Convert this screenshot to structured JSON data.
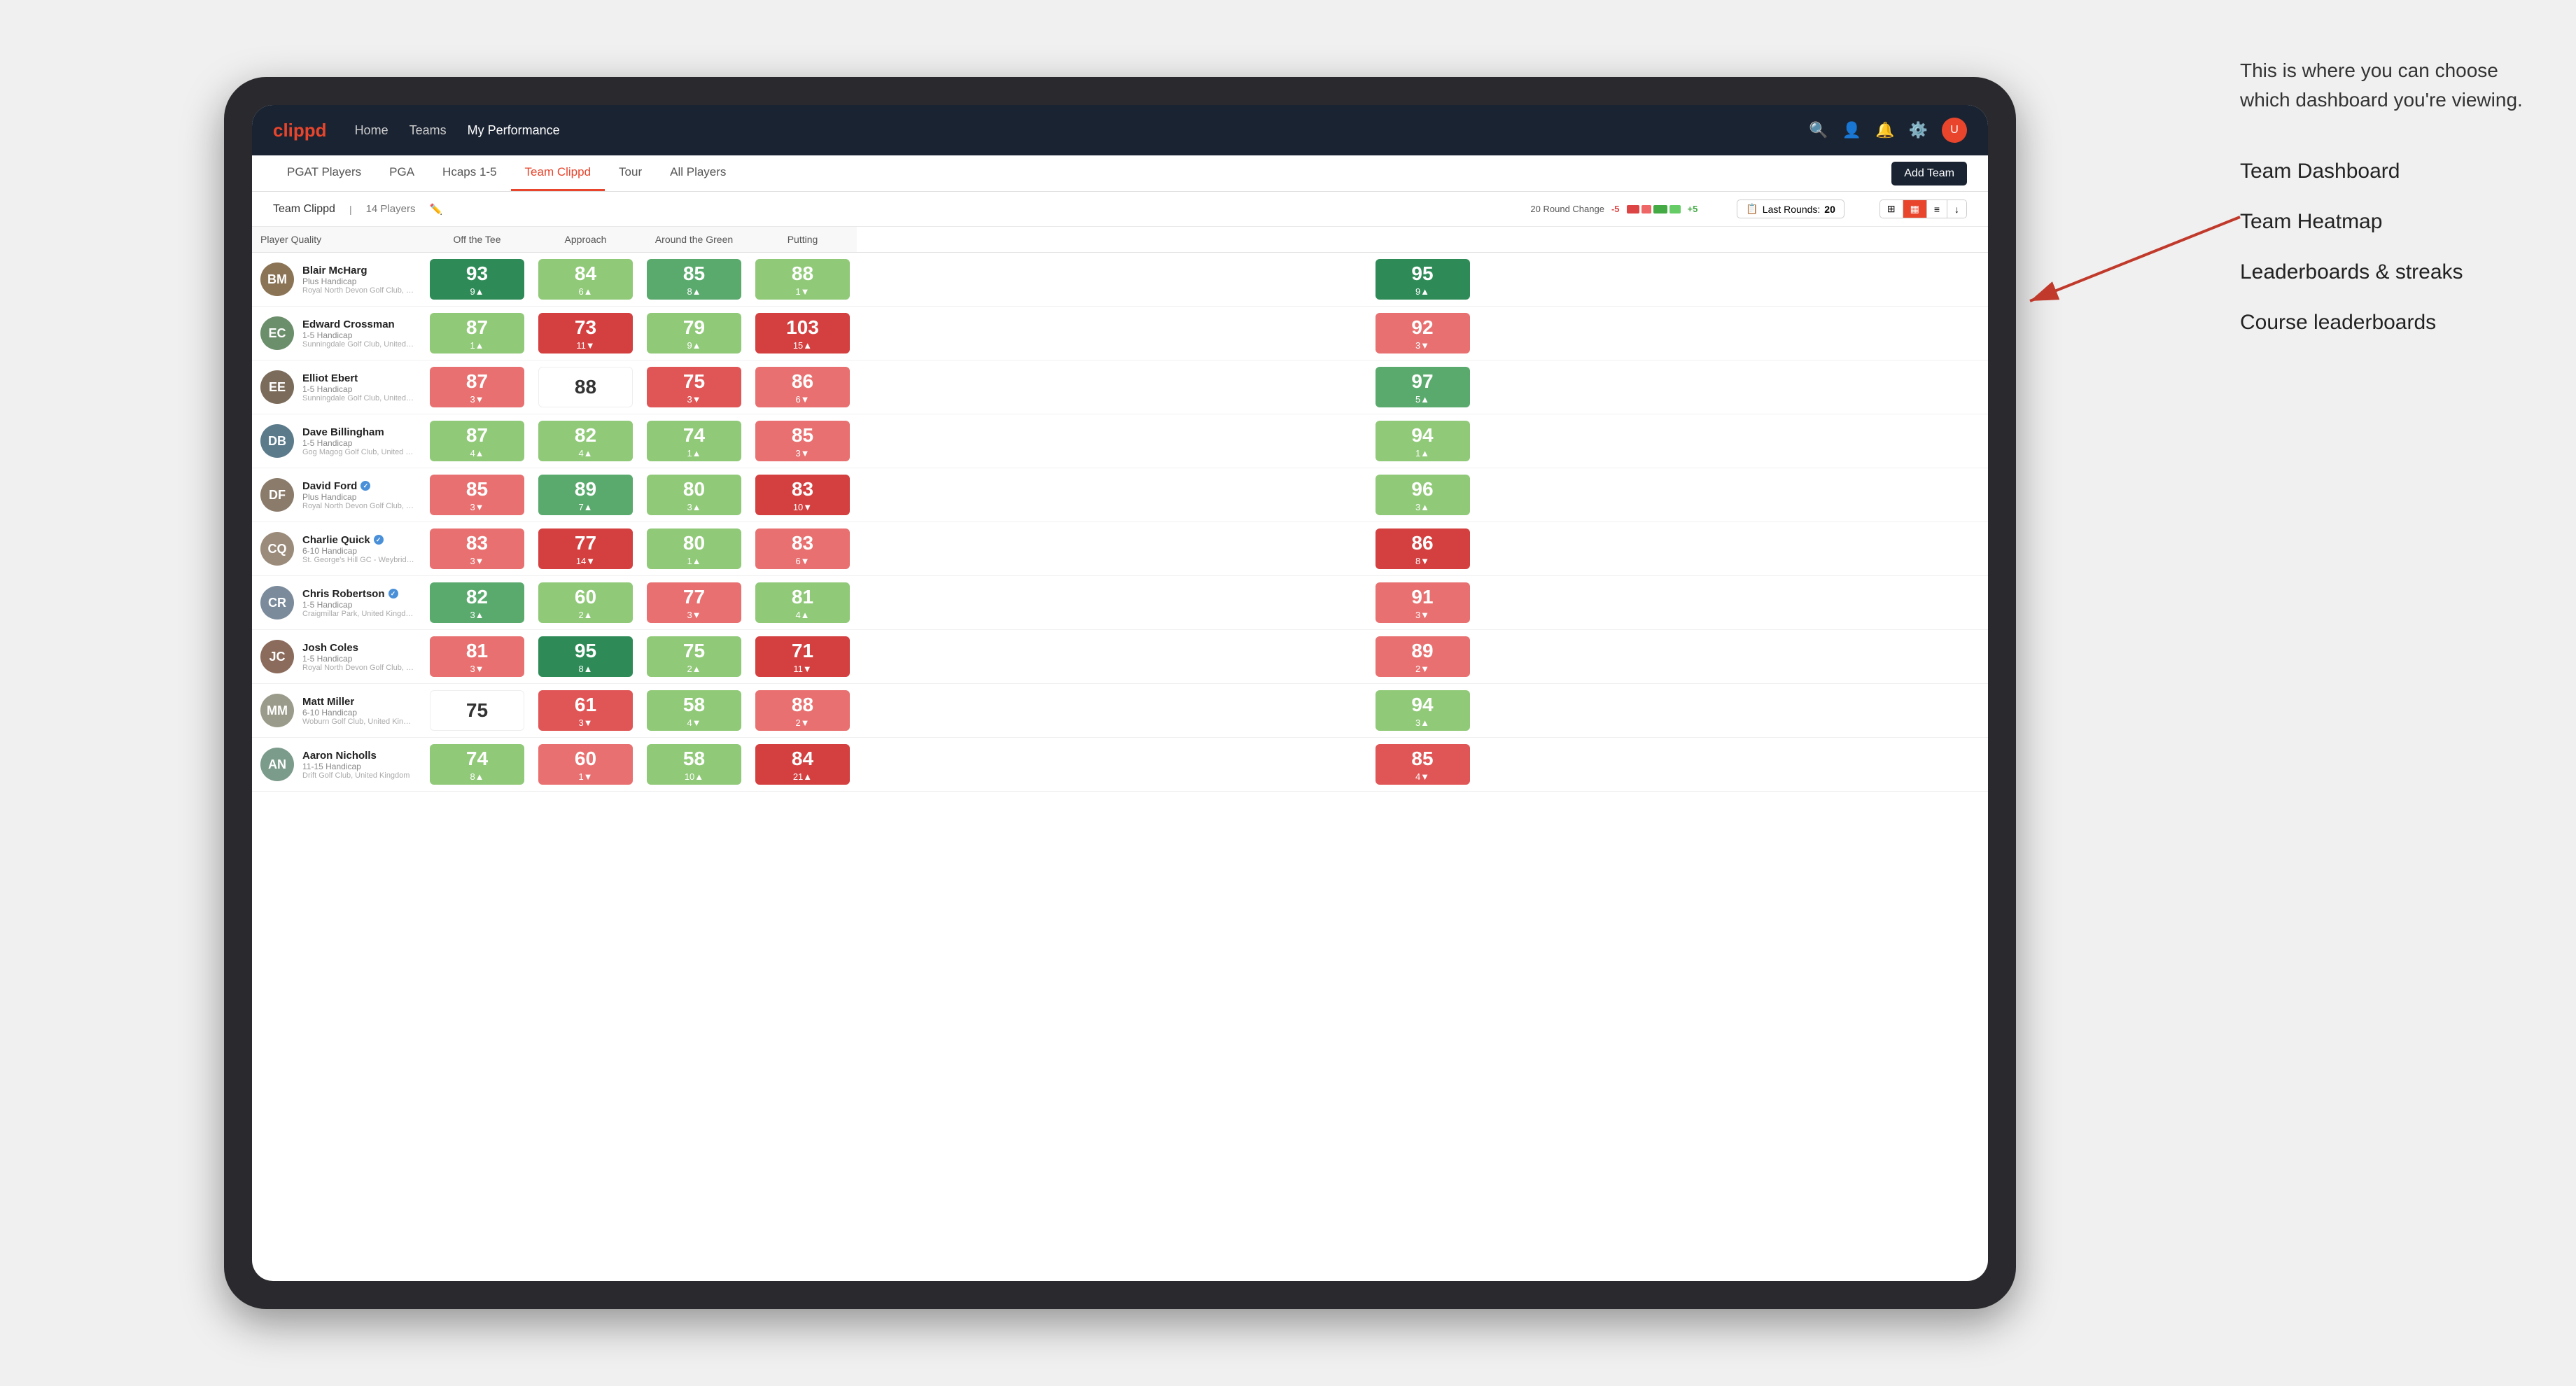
{
  "annotation": {
    "intro": "This is where you can choose which dashboard you're viewing.",
    "items": [
      "Team Dashboard",
      "Team Heatmap",
      "Leaderboards & streaks",
      "Course leaderboards"
    ]
  },
  "nav": {
    "logo": "clippd",
    "links": [
      "Home",
      "Teams",
      "My Performance"
    ],
    "active_link": "My Performance"
  },
  "sub_tabs": [
    "PGAT Players",
    "PGA",
    "Hcaps 1-5",
    "Team Clippd",
    "Tour",
    "All Players"
  ],
  "active_sub_tab": "Team Clippd",
  "add_team_label": "Add Team",
  "team": {
    "name": "Team Clippd",
    "count": "14 Players"
  },
  "filters": {
    "round_change_label": "20 Round Change",
    "round_change_minus": "-5",
    "round_change_plus": "+5",
    "last_rounds_label": "Last Rounds:",
    "last_rounds_value": "20"
  },
  "columns": {
    "player": "Player Quality",
    "off_tee": "Off the Tee",
    "approach": "Approach",
    "around_green": "Around the Green",
    "putting": "Putting"
  },
  "players": [
    {
      "name": "Blair McHarg",
      "handicap": "Plus Handicap",
      "club": "Royal North Devon Golf Club, United Kingdom",
      "initials": "BM",
      "avatar_color": "#8B7355",
      "quality": {
        "value": "93",
        "change": "9",
        "dir": "up",
        "bg": "bg-green-dark"
      },
      "off_tee": {
        "value": "84",
        "change": "6",
        "dir": "up",
        "bg": "bg-green-light"
      },
      "approach": {
        "value": "85",
        "change": "8",
        "dir": "up",
        "bg": "bg-green-mid"
      },
      "around_green": {
        "value": "88",
        "change": "1",
        "dir": "down",
        "bg": "bg-green-light"
      },
      "putting": {
        "value": "95",
        "change": "9",
        "dir": "up",
        "bg": "bg-green-dark"
      }
    },
    {
      "name": "Edward Crossman",
      "handicap": "1-5 Handicap",
      "club": "Sunningdale Golf Club, United Kingdom",
      "initials": "EC",
      "avatar_color": "#6B8E6B",
      "quality": {
        "value": "87",
        "change": "1",
        "dir": "up",
        "bg": "bg-green-light"
      },
      "off_tee": {
        "value": "73",
        "change": "11",
        "dir": "down",
        "bg": "bg-red-dark"
      },
      "approach": {
        "value": "79",
        "change": "9",
        "dir": "up",
        "bg": "bg-green-light"
      },
      "around_green": {
        "value": "103",
        "change": "15",
        "dir": "up",
        "bg": "bg-red-dark"
      },
      "putting": {
        "value": "92",
        "change": "3",
        "dir": "down",
        "bg": "bg-red-light"
      }
    },
    {
      "name": "Elliot Ebert",
      "handicap": "1-5 Handicap",
      "club": "Sunningdale Golf Club, United Kingdom",
      "initials": "EE",
      "avatar_color": "#7B6B5B",
      "quality": {
        "value": "87",
        "change": "3",
        "dir": "down",
        "bg": "bg-red-light"
      },
      "off_tee": {
        "value": "88",
        "change": "",
        "dir": "",
        "bg": "bg-white"
      },
      "approach": {
        "value": "75",
        "change": "3",
        "dir": "down",
        "bg": "bg-red-mid"
      },
      "around_green": {
        "value": "86",
        "change": "6",
        "dir": "down",
        "bg": "bg-red-light"
      },
      "putting": {
        "value": "97",
        "change": "5",
        "dir": "up",
        "bg": "bg-green-mid"
      }
    },
    {
      "name": "Dave Billingham",
      "handicap": "1-5 Handicap",
      "club": "Gog Magog Golf Club, United Kingdom",
      "initials": "DB",
      "avatar_color": "#5B7B8B",
      "quality": {
        "value": "87",
        "change": "4",
        "dir": "up",
        "bg": "bg-green-light"
      },
      "off_tee": {
        "value": "82",
        "change": "4",
        "dir": "up",
        "bg": "bg-green-light"
      },
      "approach": {
        "value": "74",
        "change": "1",
        "dir": "up",
        "bg": "bg-green-light"
      },
      "around_green": {
        "value": "85",
        "change": "3",
        "dir": "down",
        "bg": "bg-red-light"
      },
      "putting": {
        "value": "94",
        "change": "1",
        "dir": "up",
        "bg": "bg-green-light"
      }
    },
    {
      "name": "David Ford",
      "handicap": "Plus Handicap",
      "club": "Royal North Devon Golf Club, United Kingdom",
      "initials": "DF",
      "avatar_color": "#8B7B6B",
      "verified": true,
      "quality": {
        "value": "85",
        "change": "3",
        "dir": "down",
        "bg": "bg-red-light"
      },
      "off_tee": {
        "value": "89",
        "change": "7",
        "dir": "up",
        "bg": "bg-green-mid"
      },
      "approach": {
        "value": "80",
        "change": "3",
        "dir": "up",
        "bg": "bg-green-light"
      },
      "around_green": {
        "value": "83",
        "change": "10",
        "dir": "down",
        "bg": "bg-red-dark"
      },
      "putting": {
        "value": "96",
        "change": "3",
        "dir": "up",
        "bg": "bg-green-light"
      }
    },
    {
      "name": "Charlie Quick",
      "handicap": "6-10 Handicap",
      "club": "St. George's Hill GC - Weybridge - Surrey, Uni...",
      "initials": "CQ",
      "avatar_color": "#9B8B7B",
      "verified": true,
      "quality": {
        "value": "83",
        "change": "3",
        "dir": "down",
        "bg": "bg-red-light"
      },
      "off_tee": {
        "value": "77",
        "change": "14",
        "dir": "down",
        "bg": "bg-red-dark"
      },
      "approach": {
        "value": "80",
        "change": "1",
        "dir": "up",
        "bg": "bg-green-light"
      },
      "around_green": {
        "value": "83",
        "change": "6",
        "dir": "down",
        "bg": "bg-red-light"
      },
      "putting": {
        "value": "86",
        "change": "8",
        "dir": "down",
        "bg": "bg-red-dark"
      }
    },
    {
      "name": "Chris Robertson",
      "handicap": "1-5 Handicap",
      "club": "Craigmillar Park, United Kingdom",
      "initials": "CR",
      "avatar_color": "#7B8B9B",
      "verified": true,
      "quality": {
        "value": "82",
        "change": "3",
        "dir": "up",
        "bg": "bg-green-mid"
      },
      "off_tee": {
        "value": "60",
        "change": "2",
        "dir": "up",
        "bg": "bg-green-light"
      },
      "approach": {
        "value": "77",
        "change": "3",
        "dir": "down",
        "bg": "bg-red-light"
      },
      "around_green": {
        "value": "81",
        "change": "4",
        "dir": "up",
        "bg": "bg-green-light"
      },
      "putting": {
        "value": "91",
        "change": "3",
        "dir": "down",
        "bg": "bg-red-light"
      }
    },
    {
      "name": "Josh Coles",
      "handicap": "1-5 Handicap",
      "club": "Royal North Devon Golf Club, United Kingdom",
      "initials": "JC",
      "avatar_color": "#8B6B5B",
      "quality": {
        "value": "81",
        "change": "3",
        "dir": "down",
        "bg": "bg-red-light"
      },
      "off_tee": {
        "value": "95",
        "change": "8",
        "dir": "up",
        "bg": "bg-green-dark"
      },
      "approach": {
        "value": "75",
        "change": "2",
        "dir": "up",
        "bg": "bg-green-light"
      },
      "around_green": {
        "value": "71",
        "change": "11",
        "dir": "down",
        "bg": "bg-red-dark"
      },
      "putting": {
        "value": "89",
        "change": "2",
        "dir": "down",
        "bg": "bg-red-light"
      }
    },
    {
      "name": "Matt Miller",
      "handicap": "6-10 Handicap",
      "club": "Woburn Golf Club, United Kingdom",
      "initials": "MM",
      "avatar_color": "#9B9B8B",
      "quality": {
        "value": "75",
        "change": "",
        "dir": "",
        "bg": "bg-white"
      },
      "off_tee": {
        "value": "61",
        "change": "3",
        "dir": "down",
        "bg": "bg-red-mid"
      },
      "approach": {
        "value": "58",
        "change": "4",
        "dir": "down",
        "bg": "bg-green-light"
      },
      "around_green": {
        "value": "88",
        "change": "2",
        "dir": "down",
        "bg": "bg-red-light"
      },
      "putting": {
        "value": "94",
        "change": "3",
        "dir": "up",
        "bg": "bg-green-light"
      }
    },
    {
      "name": "Aaron Nicholls",
      "handicap": "11-15 Handicap",
      "club": "Drift Golf Club, United Kingdom",
      "initials": "AN",
      "avatar_color": "#7B9B8B",
      "quality": {
        "value": "74",
        "change": "8",
        "dir": "up",
        "bg": "bg-green-light"
      },
      "off_tee": {
        "value": "60",
        "change": "1",
        "dir": "down",
        "bg": "bg-red-light"
      },
      "approach": {
        "value": "58",
        "change": "10",
        "dir": "up",
        "bg": "bg-green-light"
      },
      "around_green": {
        "value": "84",
        "change": "21",
        "dir": "up",
        "bg": "bg-red-dark"
      },
      "putting": {
        "value": "85",
        "change": "4",
        "dir": "down",
        "bg": "bg-red-mid"
      }
    }
  ]
}
